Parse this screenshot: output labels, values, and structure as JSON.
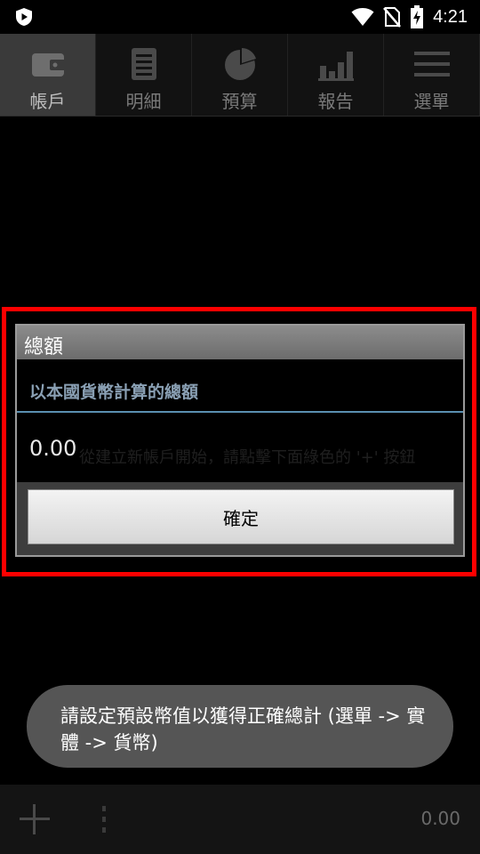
{
  "status_bar": {
    "time": "4:21",
    "icons": [
      "play-protect-icon",
      "wifi-icon",
      "no-sim-icon",
      "battery-charging-icon"
    ]
  },
  "tabs": [
    {
      "label": "帳戶",
      "icon": "wallet-icon",
      "active": true
    },
    {
      "label": "明細",
      "icon": "list-icon",
      "active": false
    },
    {
      "label": "預算",
      "icon": "pie-chart-icon",
      "active": false
    },
    {
      "label": "報告",
      "icon": "bar-chart-icon",
      "active": false
    },
    {
      "label": "選單",
      "icon": "menu-icon",
      "active": false
    }
  ],
  "dialog": {
    "title": "總額",
    "subtitle": "以本國貨幣計算的總額",
    "value": "0.00",
    "background_hint": "從建立新帳戶開始，請點擊下面綠色的 '+' 按鈕",
    "ok_label": "確定"
  },
  "toast": {
    "message": "請設定預設幣值以獲得正確總計 (選單 -> 實體 -> 貨幣)"
  },
  "bottom_bar": {
    "total": "0.00"
  },
  "colors": {
    "highlight": "#ff0000",
    "subtitle": "#8aa0b4",
    "divider": "#5a8fb0"
  }
}
